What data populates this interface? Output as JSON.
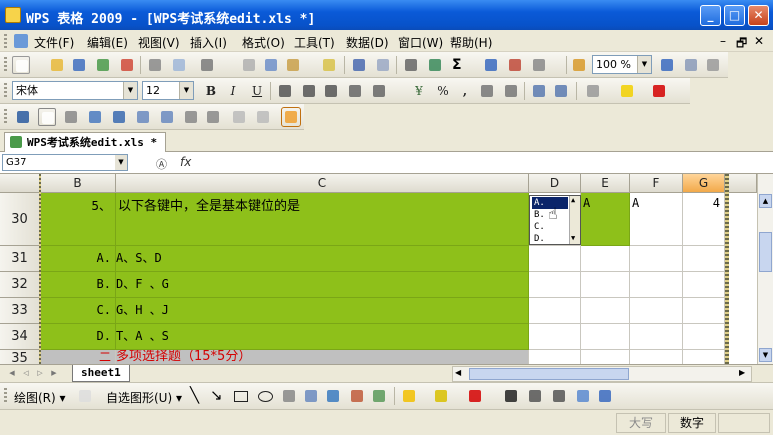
{
  "window": {
    "title": "WPS 表格 2009 - [WPS考试系统edit.xls *]",
    "minimize_glyph": "_",
    "maximize_glyph": "□",
    "close_glyph": "✕"
  },
  "menubar": {
    "items": [
      "文件(F)",
      "编辑(E)",
      "视图(V)",
      "插入(I)",
      "格式(O)",
      "工具(T)",
      "数据(D)",
      "窗口(W)",
      "帮助(H)"
    ],
    "doc_controls": [
      "–",
      "🗗",
      "✕"
    ]
  },
  "standard_toolbar": {
    "zoom": "100 %",
    "sigma": "Σ"
  },
  "format_toolbar": {
    "font_name": "宋体",
    "font_size": "12",
    "bold": "B",
    "italic": "I",
    "underline": "U",
    "currency": "¥",
    "percent": "%",
    "thousands": ","
  },
  "document_tab": {
    "label": "WPS考试系统edit.xls *"
  },
  "formula_bar": {
    "name_box": "G37",
    "fx_label": "fx"
  },
  "grid": {
    "columns": [
      "B",
      "C",
      "D",
      "E",
      "F",
      "G"
    ],
    "active_column": "G",
    "rows": [
      {
        "row": "30",
        "B": "5、",
        "C": "以下各键中，全是基本键位的是",
        "D": "",
        "E": "A",
        "F": "A",
        "G": "4"
      },
      {
        "row": "31",
        "B": "A.",
        "C": "A、S、D",
        "D": "",
        "E": "",
        "F": "",
        "G": ""
      },
      {
        "row": "32",
        "B": "B.",
        "C": "D、F 、G",
        "D": "",
        "E": "",
        "F": "",
        "G": ""
      },
      {
        "row": "33",
        "B": "C.",
        "C": "G、H 、J",
        "D": "",
        "E": "",
        "F": "",
        "G": ""
      },
      {
        "row": "34",
        "B": "D.",
        "C": "T、A 、S",
        "D": "",
        "E": "",
        "F": "",
        "G": ""
      },
      {
        "row": "35",
        "B": "二",
        "C": "多项选择题（15*5分）",
        "D": "",
        "E": "",
        "F": "",
        "G": ""
      }
    ],
    "validation_options": [
      "A.",
      "B.",
      "C.",
      "D."
    ],
    "validation_selected": "A."
  },
  "sheet_tabs": {
    "tabs": [
      "sheet1"
    ],
    "active": "sheet1"
  },
  "drawing_toolbar": {
    "draw_label": "绘图(R)",
    "autoshape_label": "自选图形(U)"
  },
  "status_bar": {
    "caps": "大写",
    "numlock": "数字"
  },
  "colors": {
    "title_bar": "#0a5ad8",
    "cell_green": "#8ec01a",
    "section_red": "#d40000",
    "active_header": "#f2a94a"
  }
}
